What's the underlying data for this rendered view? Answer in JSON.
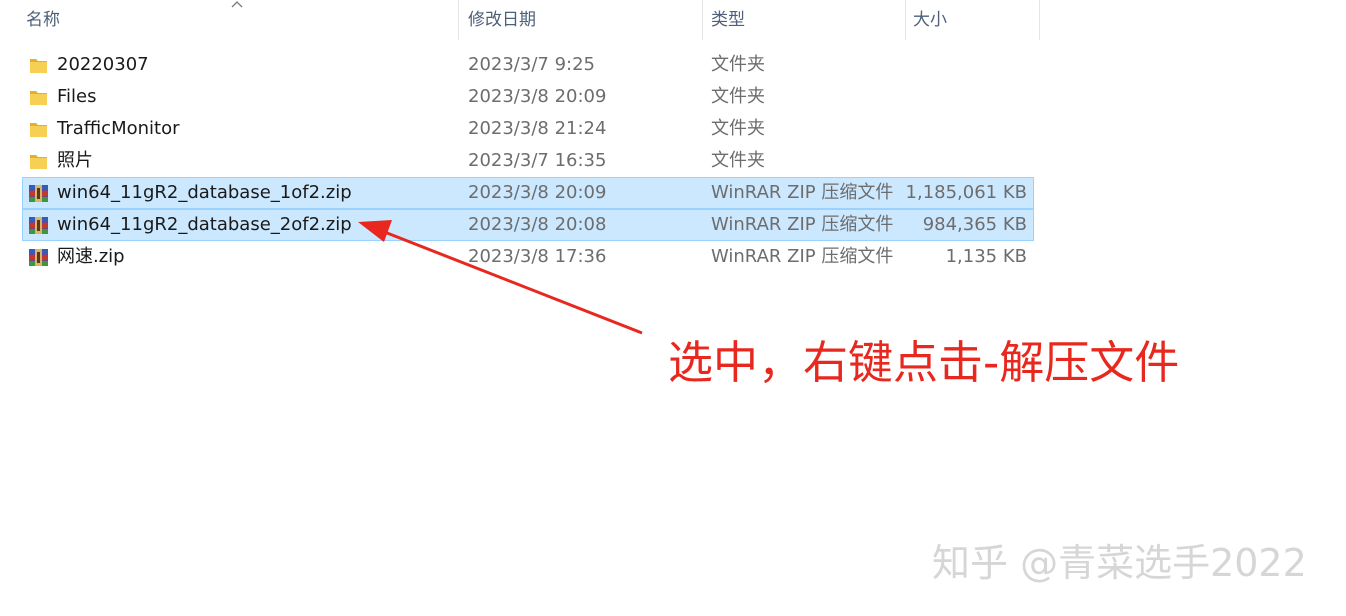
{
  "columns": {
    "name": "名称",
    "date": "修改日期",
    "type": "类型",
    "size": "大小"
  },
  "files": [
    {
      "name": "20220307",
      "date": "2023/3/7 9:25",
      "type": "文件夹",
      "size": "",
      "icon": "folder-icon",
      "selected": false
    },
    {
      "name": "Files",
      "date": "2023/3/8 20:09",
      "type": "文件夹",
      "size": "",
      "icon": "folder-icon",
      "selected": false
    },
    {
      "name": "TrafficMonitor",
      "date": "2023/3/8 21:24",
      "type": "文件夹",
      "size": "",
      "icon": "folder-icon",
      "selected": false
    },
    {
      "name": "照片",
      "date": "2023/3/7 16:35",
      "type": "文件夹",
      "size": "",
      "icon": "folder-icon",
      "selected": false
    },
    {
      "name": "win64_11gR2_database_1of2.zip",
      "date": "2023/3/8 20:09",
      "type": "WinRAR ZIP 压缩文件",
      "size": "1,185,061 KB",
      "icon": "winrar-archive-icon",
      "selected": true
    },
    {
      "name": "win64_11gR2_database_2of2.zip",
      "date": "2023/3/8 20:08",
      "type": "WinRAR ZIP 压缩文件",
      "size": "984,365 KB",
      "icon": "winrar-archive-icon",
      "selected": true
    },
    {
      "name": "网速.zip",
      "date": "2023/3/8 17:36",
      "type": "WinRAR ZIP 压缩文件",
      "size": "1,135 KB",
      "icon": "winrar-archive-icon",
      "selected": false
    }
  ],
  "annotation": {
    "text": "选中，右键点击-解压文件",
    "color": "#e8281e"
  },
  "watermark": "知乎 @青菜选手2022",
  "colors": {
    "selection_bg": "#cce8ff",
    "selection_border": "#99d1ff",
    "folder": "#f5c341",
    "header_text": "#4c607a"
  }
}
